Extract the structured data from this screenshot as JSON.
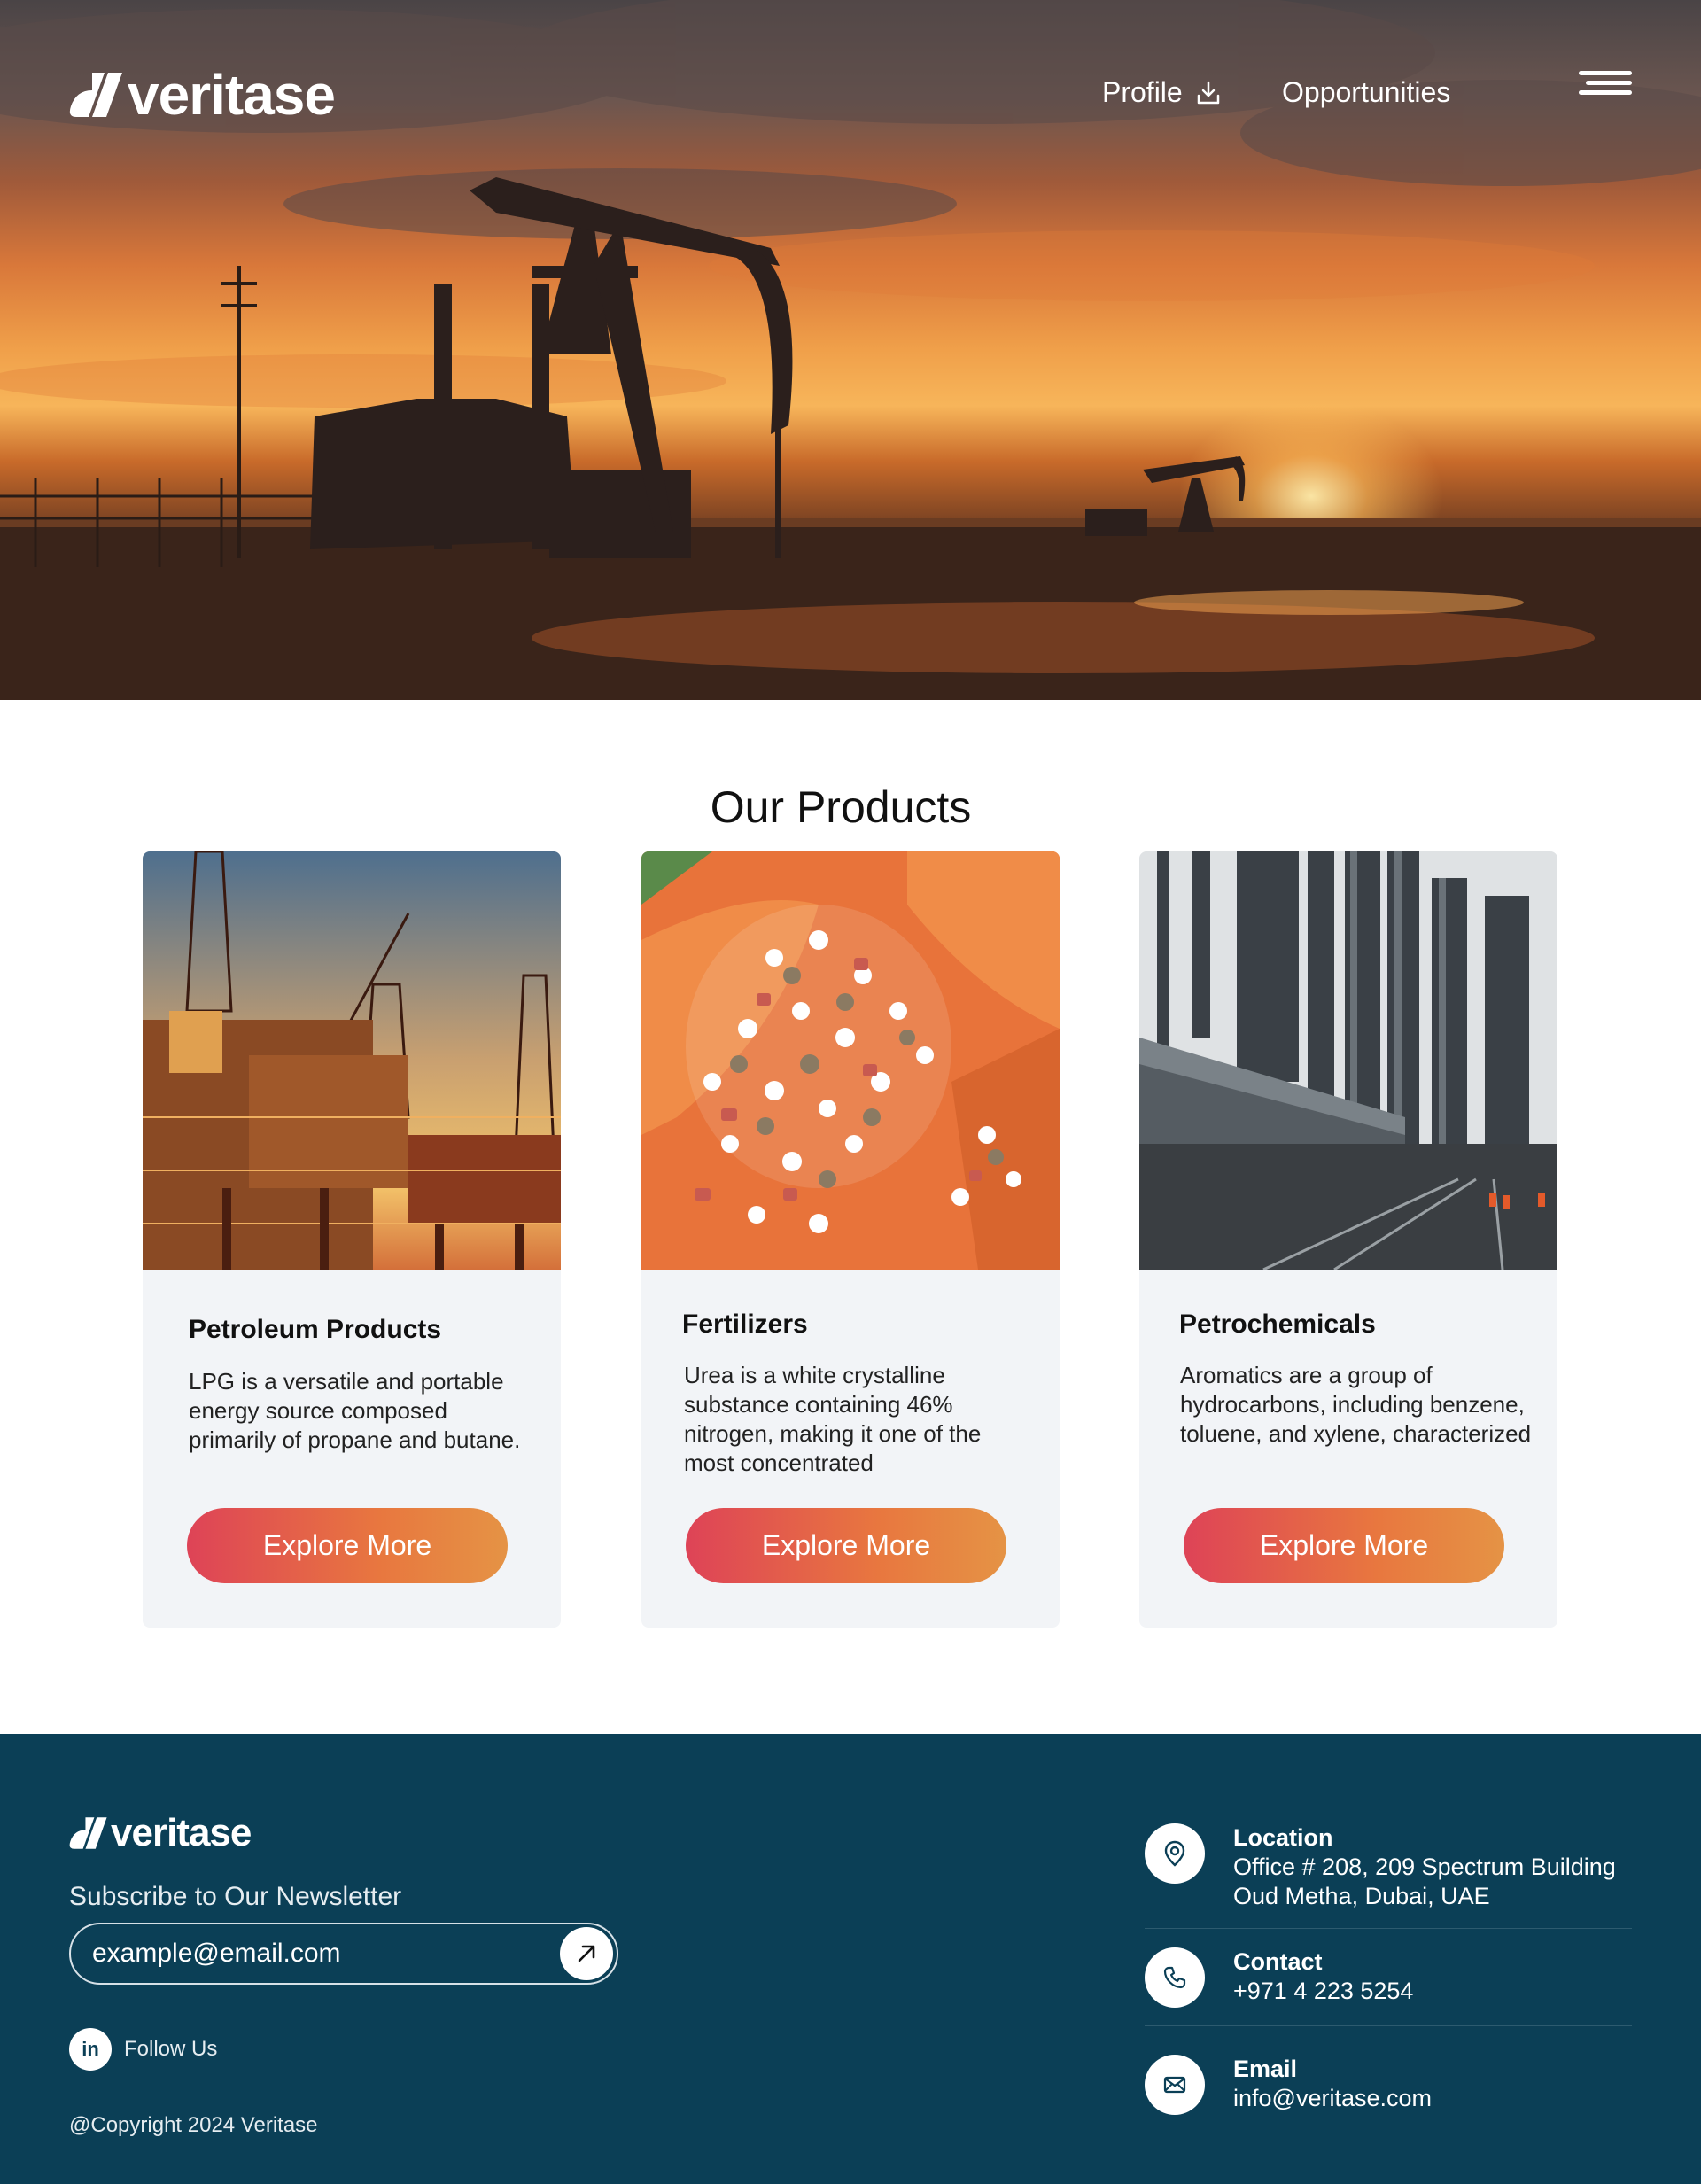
{
  "header": {
    "logo_text": "veritase",
    "nav": {
      "profile_label": "Profile",
      "opportunities_label": "Opportunities"
    }
  },
  "products": {
    "title": "Our Products",
    "items": [
      {
        "title": "Petroleum Products",
        "description": "LPG is a versatile and portable energy source composed primarily of propane and butane.",
        "button_label": "Explore More"
      },
      {
        "title": "Fertilizers",
        "description": "Urea is a white crystalline substance containing 46% nitrogen, making it one of the most concentrated",
        "button_label": "Explore More"
      },
      {
        "title": "Petrochemicals",
        "description": "Aromatics are a group of hydrocarbons, including benzene, toluene, and xylene, characterized",
        "button_label": "Explore More"
      }
    ]
  },
  "footer": {
    "logo_text": "veritase",
    "newsletter_label": "Subscribe to Our Newsletter",
    "newsletter_placeholder": "example@email.com",
    "follow_label": "Follow Us",
    "copyright": "@Copyright 2024 Veritase",
    "contacts": [
      {
        "icon": "location-pin-icon",
        "title": "Location",
        "line1": "Office # 208, 209 Spectrum Building",
        "line2": "Oud Metha, Dubai, UAE"
      },
      {
        "icon": "phone-icon",
        "title": "Contact",
        "line1": "+971 4 223 5254"
      },
      {
        "icon": "mail-icon",
        "title": "Email",
        "line1": "info@veritase.com"
      }
    ]
  },
  "colors": {
    "brand_dark": "#0b3f56",
    "button_gradient_start": "#de4357",
    "button_gradient_end": "#e59345",
    "card_bg": "#f2f4f7"
  }
}
